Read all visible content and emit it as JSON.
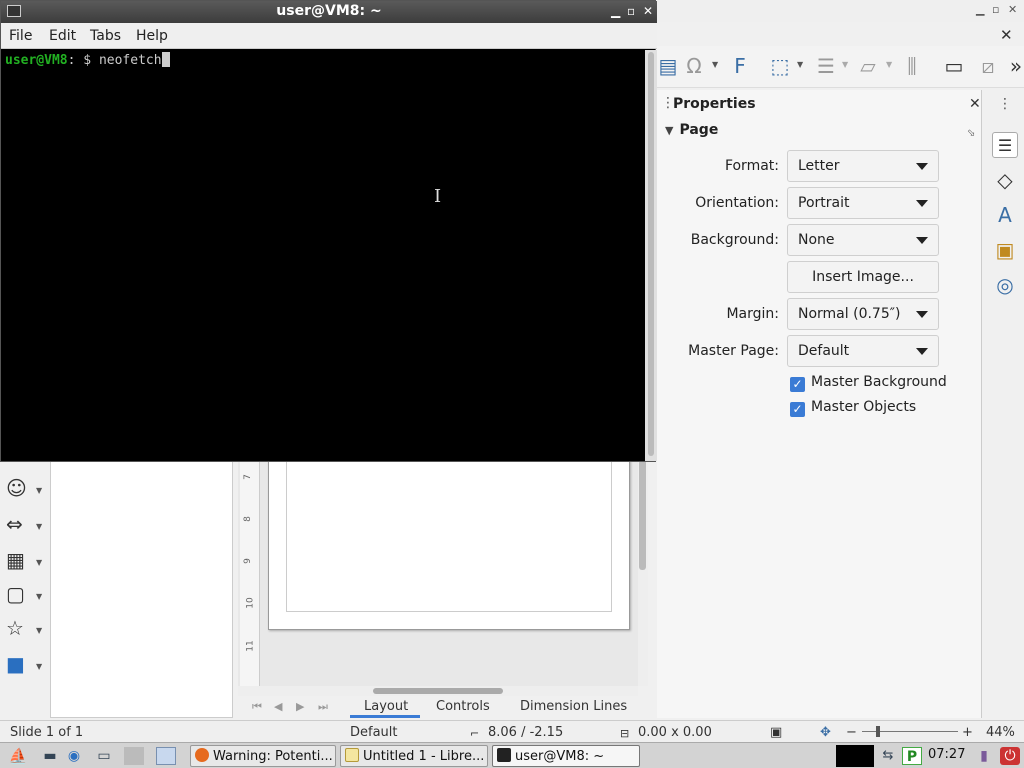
{
  "terminal": {
    "title": "user@VM8: ~",
    "menu": [
      "File",
      "Edit",
      "Tabs",
      "Help"
    ],
    "prompt_user": "user@VM8",
    "prompt_sep": ":",
    "prompt_path": " ",
    "prompt_symbol": "$ ",
    "command": "neofetch"
  },
  "draw": {
    "properties": {
      "title": "Properties",
      "section": "Page",
      "fields": {
        "format_label": "Format:",
        "format_value": "Letter",
        "orientation_label": "Orientation:",
        "orientation_value": "Portrait",
        "background_label": "Background:",
        "background_value": "None",
        "insert_image": "Insert Image...",
        "margin_label": "Margin:",
        "margin_value": "Normal (0.75″)",
        "master_page_label": "Master Page:",
        "master_page_value": "Default",
        "master_background": "Master Background",
        "master_objects": "Master Objects"
      },
      "master_background_checked": true,
      "master_objects_checked": true
    },
    "ruler_numbers": [
      "7",
      "8",
      "9",
      "10",
      "11"
    ],
    "layer_tabs": [
      "Layout",
      "Controls",
      "Dimension Lines"
    ],
    "statusbar": {
      "slide": "Slide 1 of 1",
      "master": "Default",
      "position": "8.06 / -2.15",
      "size": "0.00 x 0.00",
      "zoom": "44%"
    }
  },
  "taskbar": {
    "tasks": [
      "Warning: Potenti...",
      "Untitled 1 - Libre...",
      "user@VM8: ~"
    ],
    "clock": "07:27"
  },
  "colors": {
    "accent": "#3a7bd5",
    "prompt_user": "#22b022",
    "terminal_bg": "#000000"
  }
}
